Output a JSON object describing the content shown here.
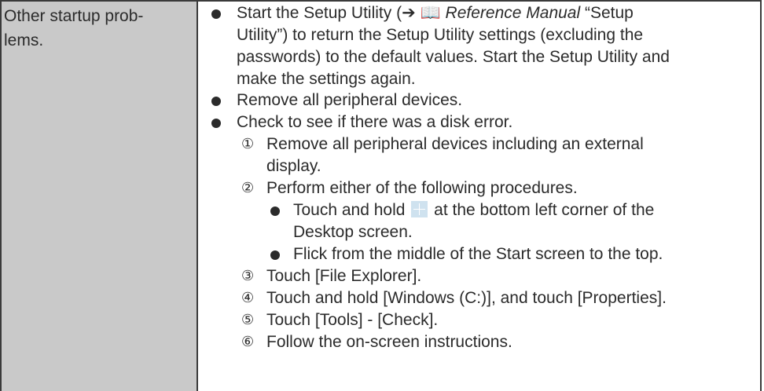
{
  "problem": {
    "line1": "Other startup prob-",
    "line2": "lems."
  },
  "bullets": {
    "b1": {
      "l1_pre": "Start the Setup Utility (",
      "arrow": "➔",
      "book_icon": "book-reference-icon",
      "ref_italic": "Reference Manual",
      "l1_post": " “Setup",
      "l2": "Utility”) to return the Setup Utility settings (excluding the",
      "l3": "passwords) to the default values. Start the Setup Utility and",
      "l4": "make the settings again."
    },
    "b2": "Remove all peripheral devices.",
    "b3": "Check to see if there was a disk error."
  },
  "steps": {
    "s1": {
      "num": "①",
      "l1": "Remove all peripheral devices including an external",
      "l2": "display."
    },
    "s2": {
      "num": "②",
      "l1": "Perform either of the following procedures."
    },
    "s2a": {
      "pre": "Touch and hold",
      "icon": "windows-start-icon",
      "post": "at the bottom left corner of the",
      "l2": "Desktop screen."
    },
    "s2b": "Flick from the middle of the Start screen to the top.",
    "s3": {
      "num": "③",
      "text": "Touch [File Explorer]."
    },
    "s4": {
      "num": "④",
      "text": "Touch and hold [Windows (C:)], and touch [Properties]."
    },
    "s5": {
      "num": "⑤",
      "text": "Touch [Tools] - [Check]."
    },
    "s6": {
      "num": "⑥",
      "text": "Follow the on-screen instructions."
    }
  }
}
